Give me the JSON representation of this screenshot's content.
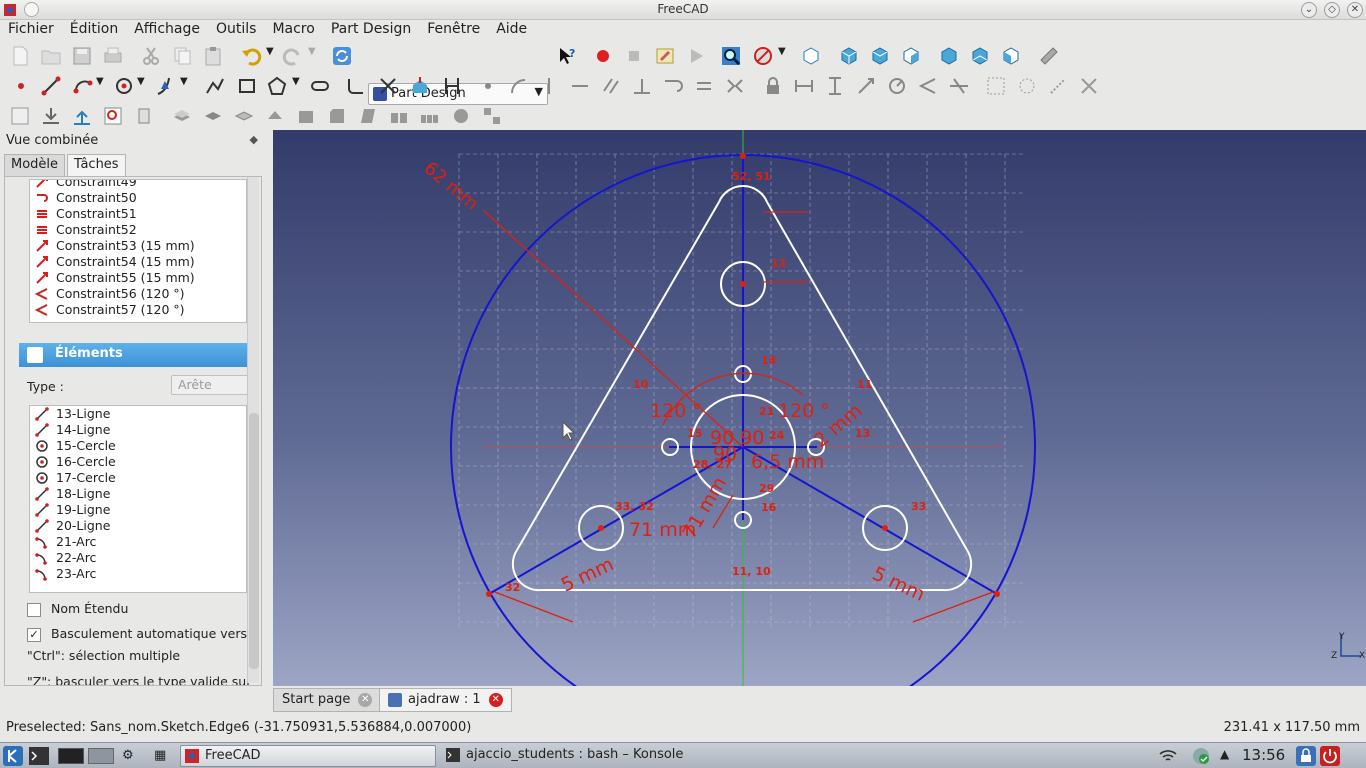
{
  "window": {
    "title": "FreeCAD"
  },
  "menu": [
    "Fichier",
    "Édition",
    "Affichage",
    "Outils",
    "Macro",
    "Part Design",
    "Fenêtre",
    "Aide"
  ],
  "workbench": {
    "selected": "Part Design"
  },
  "panel": {
    "title": "Vue combinée",
    "tabs": [
      "Modèle",
      "Tâches"
    ],
    "constraints": [
      {
        "label": "Constraint49",
        "icon": "distance-icon"
      },
      {
        "label": "Constraint50",
        "icon": "tangent-icon"
      },
      {
        "label": "Constraint51",
        "icon": "equal-icon"
      },
      {
        "label": "Constraint52",
        "icon": "equal-icon"
      },
      {
        "label": "Constraint53 (15 mm)",
        "icon": "distance-icon"
      },
      {
        "label": "Constraint54 (15 mm)",
        "icon": "distance-icon"
      },
      {
        "label": "Constraint55 (15 mm)",
        "icon": "distance-icon"
      },
      {
        "label": "Constraint56 (120 °)",
        "icon": "angle-icon"
      },
      {
        "label": "Constraint57 (120 °)",
        "icon": "angle-icon"
      }
    ],
    "elements_header": "Éléments",
    "type_label": "Type :",
    "type_value": "Arête",
    "elements": [
      {
        "label": "13-Ligne",
        "icon": "line-icon"
      },
      {
        "label": "14-Ligne",
        "icon": "line-icon"
      },
      {
        "label": "15-Cercle",
        "icon": "circle-icon"
      },
      {
        "label": "16-Cercle",
        "icon": "circle-icon"
      },
      {
        "label": "17-Cercle",
        "icon": "circle-icon"
      },
      {
        "label": "18-Ligne",
        "icon": "line-icon"
      },
      {
        "label": "19-Ligne",
        "icon": "line-icon"
      },
      {
        "label": "20-Ligne",
        "icon": "line-icon"
      },
      {
        "label": "21-Arc",
        "icon": "arc-icon"
      },
      {
        "label": "22-Arc",
        "icon": "arc-icon"
      },
      {
        "label": "23-Arc",
        "icon": "arc-icon"
      }
    ],
    "extended_name": {
      "label": "Nom Étendu",
      "checked": false
    },
    "auto_switch": {
      "label": "Basculement automatique vers",
      "checked": true
    },
    "hint1": "\"Ctrl\": sélection multiple",
    "hint2": "\"Z\": basculer vers le type valide sui"
  },
  "sketch_labels": {
    "dim_62": "62 mm",
    "c_52_51": "52, 51",
    "c_12": "12",
    "c_14": "14",
    "c_10": "10",
    "c_11": "11",
    "ang_left": "120 °",
    "ang_right": "120 °",
    "c_21": "21",
    "ninety": "90 90",
    "c_24": "24",
    "c_15": "15",
    "c_13": "13",
    "c_28_27": "28, 27",
    "c_65": "6,5 mm",
    "c_90b": "90",
    "c_29": "29",
    "c_16": "16",
    "c_33_32": "33, 32",
    "c_33": "33",
    "dim_71a": "71 mm",
    "dim_71b": "71 mm",
    "dim_5a": "5 mm",
    "dim_5b": "5 mm",
    "c_11_10": "11, 10",
    "c_32": "32",
    "dim_2mm": "2 mm"
  },
  "doc_tabs": [
    "Start page",
    "ajadraw : 1"
  ],
  "status": {
    "message": "Preselected: Sans_nom.Sketch.Edge6 (-31.750931,5.536884,0.007000)",
    "dimensions": "231.41 x 117.50 mm"
  },
  "taskbar": {
    "apps": [
      "FreeCAD",
      "ajaccio_students : bash – Konsole"
    ],
    "clock": "13:56"
  },
  "axis": {
    "y": "Y",
    "z": "Z",
    "x": "X"
  },
  "colors": {
    "sketch_line": "#ffffff",
    "construction": "#1414d2",
    "constraint": "#e0200e",
    "selection_header": "#3b92d6"
  }
}
